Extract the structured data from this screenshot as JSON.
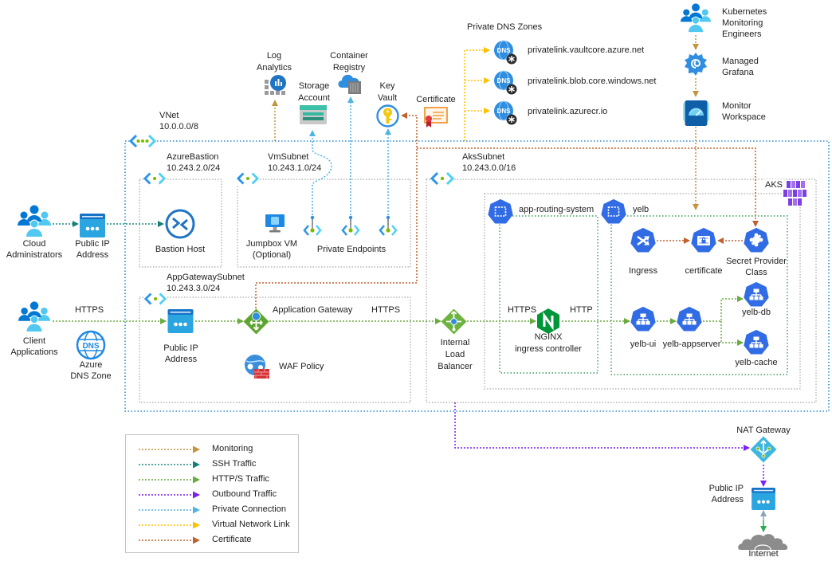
{
  "containers": {
    "vnet": {
      "name": "VNet",
      "cidr": "10.0.0.0/8"
    },
    "azure_bastion_subnet": {
      "name": "AzureBastion",
      "cidr": "10.243.2.0/24"
    },
    "vm_subnet": {
      "name": "VmSubnet",
      "cidr": "10.243.1.0/24"
    },
    "appgw_subnet": {
      "name": "AppGatewaySubnet",
      "cidr": "10.243.3.0/24"
    },
    "aks_subnet": {
      "name": "AksSubnet",
      "cidr": "10.243.0.0/16"
    },
    "aks_cluster": {
      "name": "AKS"
    },
    "ns_app_routing": {
      "name": "app-routing-system"
    },
    "ns_yelb": {
      "name": "yelb"
    }
  },
  "private_dns": {
    "title": "Private DNS Zones",
    "zones": [
      "privatelink.vaultcore.azure.net",
      "privatelink.blob.core.windows.net",
      "privatelink.azurecr.io"
    ]
  },
  "icon_text": {
    "dns": "DNS"
  },
  "nodes": {
    "log_analytics": {
      "lines": [
        "Log",
        "Analytics"
      ],
      "icon": "log-analytics-icon"
    },
    "container_registry": {
      "lines": [
        "Container",
        "Registry"
      ],
      "icon": "container-registry-icon"
    },
    "storage_account": {
      "lines": [
        "Storage",
        "Account"
      ],
      "icon": "storage-account-icon"
    },
    "key_vault": {
      "lines": [
        "Key",
        "Vault"
      ],
      "icon": "key-vault-icon"
    },
    "certificate": {
      "lines": [
        "Certificate"
      ],
      "icon": "certificate-icon"
    },
    "k8s_monitoring_engineers": {
      "lines": [
        "Kubernetes",
        "Monitoring",
        "Engineers"
      ],
      "icon": "users-group-icon"
    },
    "managed_grafana": {
      "lines": [
        "Managed",
        "Grafana"
      ],
      "icon": "grafana-icon"
    },
    "monitor_workspace": {
      "lines": [
        "Monitor",
        "Workspace"
      ],
      "icon": "monitor-workspace-icon"
    },
    "cloud_administrators": {
      "lines": [
        "Cloud",
        "Administrators"
      ],
      "icon": "users-group-icon"
    },
    "public_ip_bastion": {
      "lines": [
        "Public IP",
        "Address"
      ],
      "icon": "public-ip-icon"
    },
    "bastion_host": {
      "lines": [
        "Bastion Host"
      ],
      "icon": "bastion-icon"
    },
    "jumpbox_vm": {
      "lines": [
        "Jumpbox VM",
        "(Optional)"
      ],
      "icon": "virtual-machine-icon"
    },
    "private_endpoints": {
      "lines": [
        "Private Endpoints"
      ],
      "icon": "private-endpoint-icon"
    },
    "client_applications": {
      "lines": [
        "Client",
        "Applications"
      ],
      "icon": "users-group-icon"
    },
    "azure_dns_zone": {
      "lines": [
        "Azure",
        "DNS Zone"
      ],
      "icon": "dns-zone-icon"
    },
    "public_ip_appgw": {
      "lines": [
        "Public IP",
        "Address"
      ],
      "icon": "public-ip-icon"
    },
    "application_gateway": {
      "lines": [
        "Application Gateway"
      ],
      "icon": "application-gateway-icon"
    },
    "waf_policy": {
      "lines": [
        "WAF Policy"
      ],
      "icon": "waf-policy-icon"
    },
    "internal_load_balancer": {
      "lines": [
        "Internal",
        "Load",
        "Balancer"
      ],
      "icon": "load-balancer-icon"
    },
    "nginx_ingress": {
      "lines": [
        "NGINX",
        "ingress controller"
      ],
      "icon": "nginx-icon"
    },
    "ingress": {
      "lines": [
        "Ingress"
      ],
      "icon": "k8s-ingress-icon"
    },
    "k8s_certificate": {
      "lines": [
        "certificate"
      ],
      "icon": "k8s-certificate-icon"
    },
    "secret_provider_class": {
      "lines": [
        "Secret Provider",
        "Class"
      ],
      "icon": "k8s-crd-icon"
    },
    "yelb_ui": {
      "lines": [
        "yelb-ui"
      ],
      "icon": "k8s-service-icon"
    },
    "yelb_appserver": {
      "lines": [
        "yelb-appserver"
      ],
      "icon": "k8s-service-icon"
    },
    "yelb_db": {
      "lines": [
        "yelb-db"
      ],
      "icon": "k8s-service-icon"
    },
    "yelb_cache": {
      "lines": [
        "yelb-cache"
      ],
      "icon": "k8s-service-icon"
    },
    "nat_gateway": {
      "lines": [
        "NAT Gateway"
      ],
      "icon": "nat-gateway-icon"
    },
    "public_ip_nat": {
      "lines": [
        "Public IP",
        "Address"
      ],
      "icon": "public-ip-icon"
    },
    "internet": {
      "lines": [
        "Internet"
      ],
      "icon": "cloud-icon"
    }
  },
  "edge_labels": {
    "client_https": "HTTPS",
    "appgw_https": "HTTPS",
    "nginx_in_https": "HTTPS",
    "nginx_out_http": "HTTP"
  },
  "legend": {
    "items": [
      {
        "label": "Monitoring",
        "color": "#c3953c"
      },
      {
        "label": "SSH Traffic",
        "color": "#1b8a84"
      },
      {
        "label": "HTTP/S Traffic",
        "color": "#6aab3f"
      },
      {
        "label": "Outbound Traffic",
        "color": "#7a1ff5"
      },
      {
        "label": "Private Connection",
        "color": "#4fb3e6"
      },
      {
        "label": "Virtual Network Link",
        "color": "#ffc000"
      },
      {
        "label": "Certificate",
        "color": "#c0622f"
      }
    ]
  }
}
